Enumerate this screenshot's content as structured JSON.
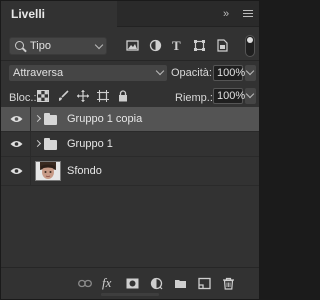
{
  "panel": {
    "title": "Livelli",
    "collapse_glyph": "»"
  },
  "filter": {
    "kind_label": "Tipo",
    "icons": [
      "pixel-filter-icon",
      "adjustment-filter-icon",
      "type-filter-icon",
      "shape-filter-icon",
      "smart-object-filter-icon"
    ],
    "type_glyph": "T"
  },
  "blend": {
    "mode": "Attraversa",
    "opacity_label": "Opacità:",
    "opacity_value": "100%"
  },
  "lock": {
    "label": "Bloc.:",
    "fill_label": "Riemp.:",
    "fill_value": "100%"
  },
  "layers": [
    {
      "name": "Gruppo 1 copia",
      "type": "group",
      "selected": true
    },
    {
      "name": "Gruppo 1",
      "type": "group",
      "selected": false
    },
    {
      "name": "Sfondo",
      "type": "image",
      "selected": false
    }
  ],
  "footer": {
    "fx_label": "fx",
    "icons": [
      "link-icon",
      "fx-icon",
      "mask-icon",
      "adjustment-layer-icon",
      "new-group-icon",
      "new-layer-icon",
      "trash-icon"
    ]
  },
  "colors": {
    "panel_bg": "#323232",
    "selected_row": "#545454",
    "field_bg": "#454545"
  }
}
